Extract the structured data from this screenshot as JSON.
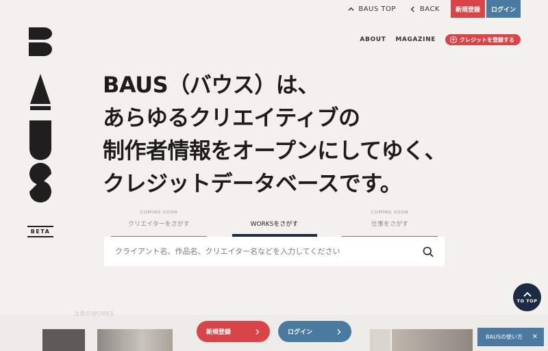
{
  "topbar": {
    "baus_top": "BAUS TOP",
    "back": "BACK",
    "signup": "新規登録",
    "login": "ログイン"
  },
  "nav": {
    "about": "ABOUT",
    "magazine": "MAGAZINE",
    "credit_button": "クレジットを登録する"
  },
  "logo": {
    "text": "BAUS",
    "badge": "BETA"
  },
  "hero": {
    "lines": [
      "BAUS（バウス）は、",
      "あらゆるクリエイティブの",
      "制作者情報をオープンにしてゆく、",
      "クレジットデータベースです。"
    ]
  },
  "search_tabs": [
    {
      "soon": "COMING SOON",
      "label": "クリエイターをさがす",
      "active": false
    },
    {
      "soon": "",
      "label": "WORKSをさがす",
      "active": true
    },
    {
      "soon": "COMING SOON",
      "label": "仕事をさがす",
      "active": false
    }
  ],
  "search": {
    "placeholder": "クライアント名、作品名、クリエイター名などを入力してください",
    "icon": "search-icon"
  },
  "pickup": {
    "label": "注目のWORKS"
  },
  "cta": {
    "signup": "新規登録",
    "login": "ログイン"
  },
  "to_top": "TO TOP",
  "howto": {
    "label": "BAUSの使い方",
    "close": "✕"
  },
  "colors": {
    "background": "#f2f1ee",
    "red": "#d84448",
    "blue": "#4b7aa1",
    "navy": "#1d2a44"
  }
}
